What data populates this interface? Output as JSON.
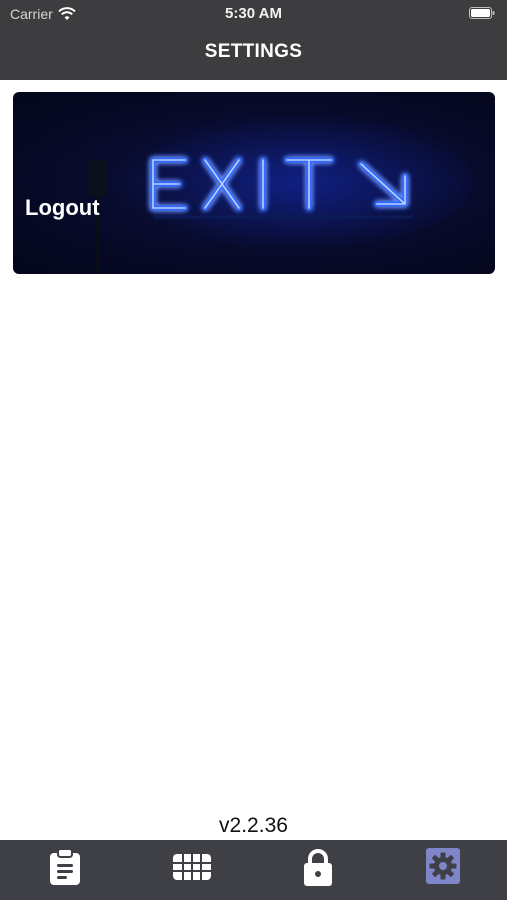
{
  "status": {
    "carrier": "Carrier",
    "time": "5:30 AM",
    "icons": [
      "wifi-icon",
      "battery-icon"
    ]
  },
  "header": {
    "title": "SETTINGS"
  },
  "logout_card": {
    "label": "Logout",
    "image_sign_text": "EXIT",
    "image_icon": "arrow-down-right-icon",
    "neon_color": "#2f6bff"
  },
  "footer": {
    "version": "v2.2.36"
  },
  "tabs": [
    {
      "icon": "clipboard-icon",
      "active": false
    },
    {
      "icon": "grid-icon",
      "active": false
    },
    {
      "icon": "lock-icon",
      "active": false
    },
    {
      "icon": "gear-icon",
      "active": true
    }
  ],
  "colors": {
    "bar": "#3d3d40",
    "tab_active": "#7e86c9",
    "background": "#ffffff"
  }
}
